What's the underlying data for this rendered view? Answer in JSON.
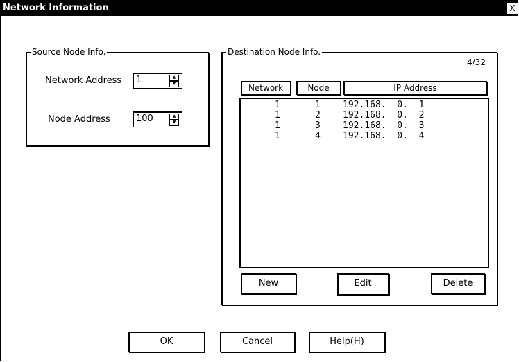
{
  "window": {
    "title": "Network Information",
    "close_glyph": "X"
  },
  "source_group": {
    "title": "Source Node Info.",
    "network_address_label": "Network Address",
    "network_address_value": "1",
    "node_address_label": "Node Address",
    "node_address_value": "100"
  },
  "destination_group": {
    "title": "Destination Node Info.",
    "counter": "4/32",
    "columns": [
      "Network",
      "Node",
      "IP Address"
    ],
    "rows": [
      {
        "network": "1",
        "node": "1",
        "ip": "192.168.  0.  1"
      },
      {
        "network": "1",
        "node": "2",
        "ip": "192.168.  0.  2"
      },
      {
        "network": "1",
        "node": "3",
        "ip": "192.168.  0.  3"
      },
      {
        "network": "1",
        "node": "4",
        "ip": "192.168.  0.  4"
      }
    ],
    "buttons": {
      "new": "New",
      "edit": "Edit",
      "delete": "Delete"
    }
  },
  "footer_buttons": {
    "ok": "OK",
    "cancel": "Cancel",
    "help": "Help(H)"
  }
}
